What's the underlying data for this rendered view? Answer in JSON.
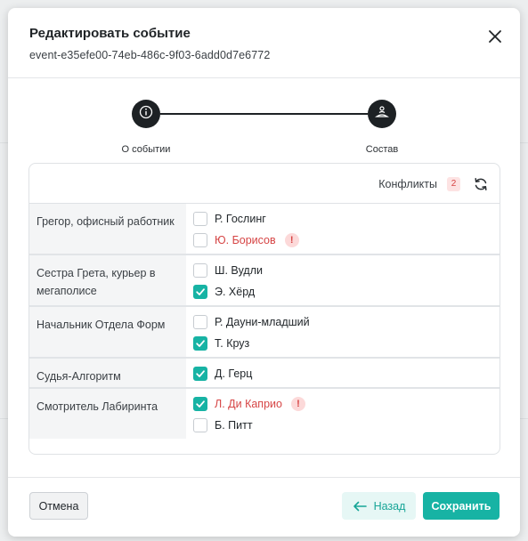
{
  "modal": {
    "title": "Редактировать событие",
    "subtitle": "event-e35efe00-74eb-486c-9f03-6add0d7e6772"
  },
  "stepper": {
    "steps": [
      {
        "label": "О событии",
        "icon": "info-icon"
      },
      {
        "label": "Состав",
        "icon": "cast-icon"
      }
    ]
  },
  "panel": {
    "conflicts_label": "Конфликты",
    "conflicts_count": "2",
    "roles": [
      {
        "name": "Грегор, офисный работник",
        "cast": [
          {
            "name": "Р. Гослинг",
            "checked": false,
            "conflict": false
          },
          {
            "name": "Ю. Борисов",
            "checked": false,
            "conflict": true
          }
        ]
      },
      {
        "name": "Сестра Грета, курьер в мегаполисе",
        "cast": [
          {
            "name": "Ш. Вудли",
            "checked": false,
            "conflict": false
          },
          {
            "name": "Э. Хёрд",
            "checked": true,
            "conflict": false
          }
        ]
      },
      {
        "name": "Начальник Отдела Форм",
        "cast": [
          {
            "name": "Р. Дауни-младший",
            "checked": false,
            "conflict": false
          },
          {
            "name": "Т. Круз",
            "checked": true,
            "conflict": false
          }
        ]
      },
      {
        "name": "Судья-Алгоритм",
        "cast": [
          {
            "name": "Д. Герц",
            "checked": true,
            "conflict": false
          }
        ]
      },
      {
        "name": "Смотритель Лабиринта",
        "cast": [
          {
            "name": "Л. Ди Каприо",
            "checked": true,
            "conflict": true
          },
          {
            "name": "Б. Питт",
            "checked": false,
            "conflict": false
          }
        ]
      }
    ]
  },
  "footer": {
    "cancel_label": "Отмена",
    "back_label": "Назад",
    "save_label": "Сохранить"
  },
  "colors": {
    "accent": "#17b3a4",
    "conflict": "#d64545",
    "dark": "#1d2124"
  }
}
